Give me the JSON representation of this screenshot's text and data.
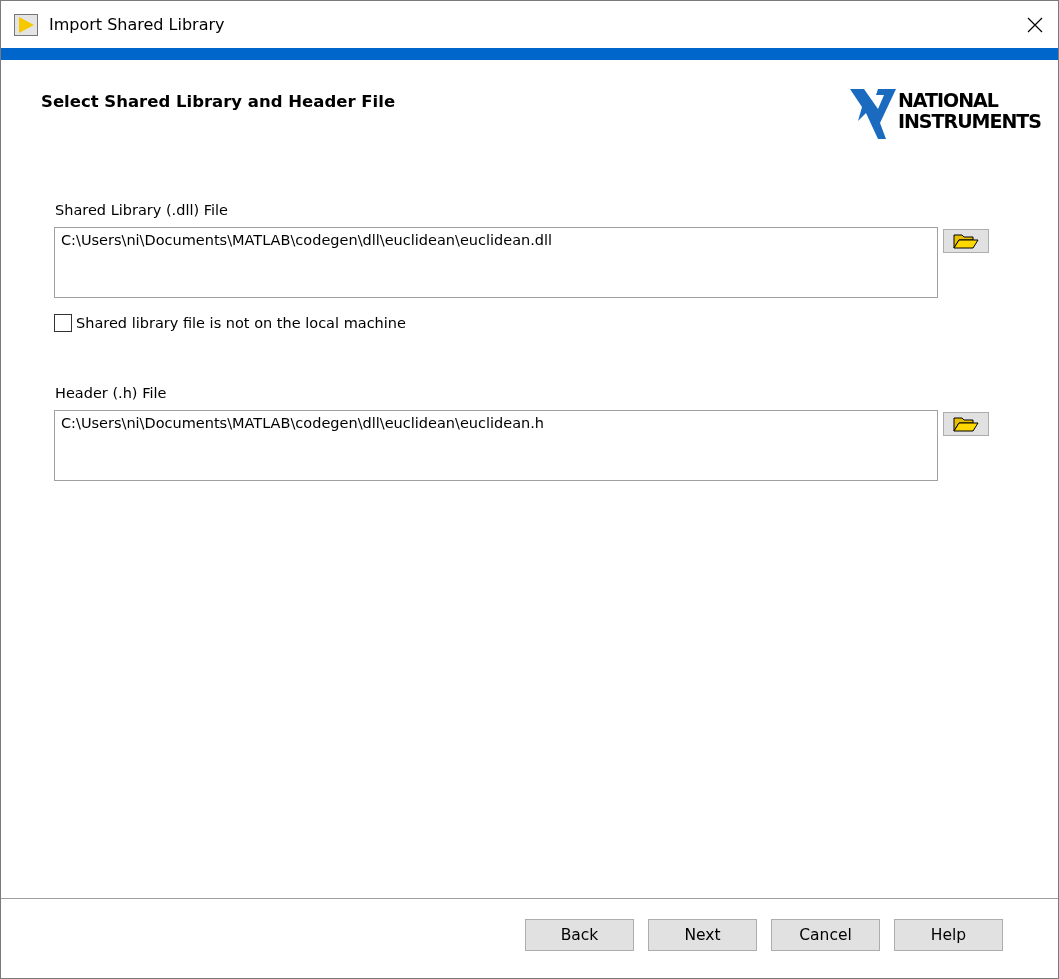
{
  "window": {
    "title": "Import Shared Library"
  },
  "page": {
    "heading": "Select Shared Library and Header File",
    "logo": [
      "NATIONAL",
      "INSTRUMENTS"
    ]
  },
  "fields": [
    {
      "label": "Shared Library (.dll) File",
      "value": "C:\\Users\\ni\\Documents\\MATLAB\\codegen\\dll\\euclidean\\euclidean.dll"
    },
    {
      "label": "Header (.h) File",
      "value": "C:\\Users\\ni\\Documents\\MATLAB\\codegen\\dll\\euclidean\\euclidean.h"
    }
  ],
  "remote_checkbox": {
    "label": "Shared library file is not on the local machine",
    "checked": false
  },
  "buttons": [
    "Back",
    "Next",
    "Cancel",
    "Help"
  ]
}
